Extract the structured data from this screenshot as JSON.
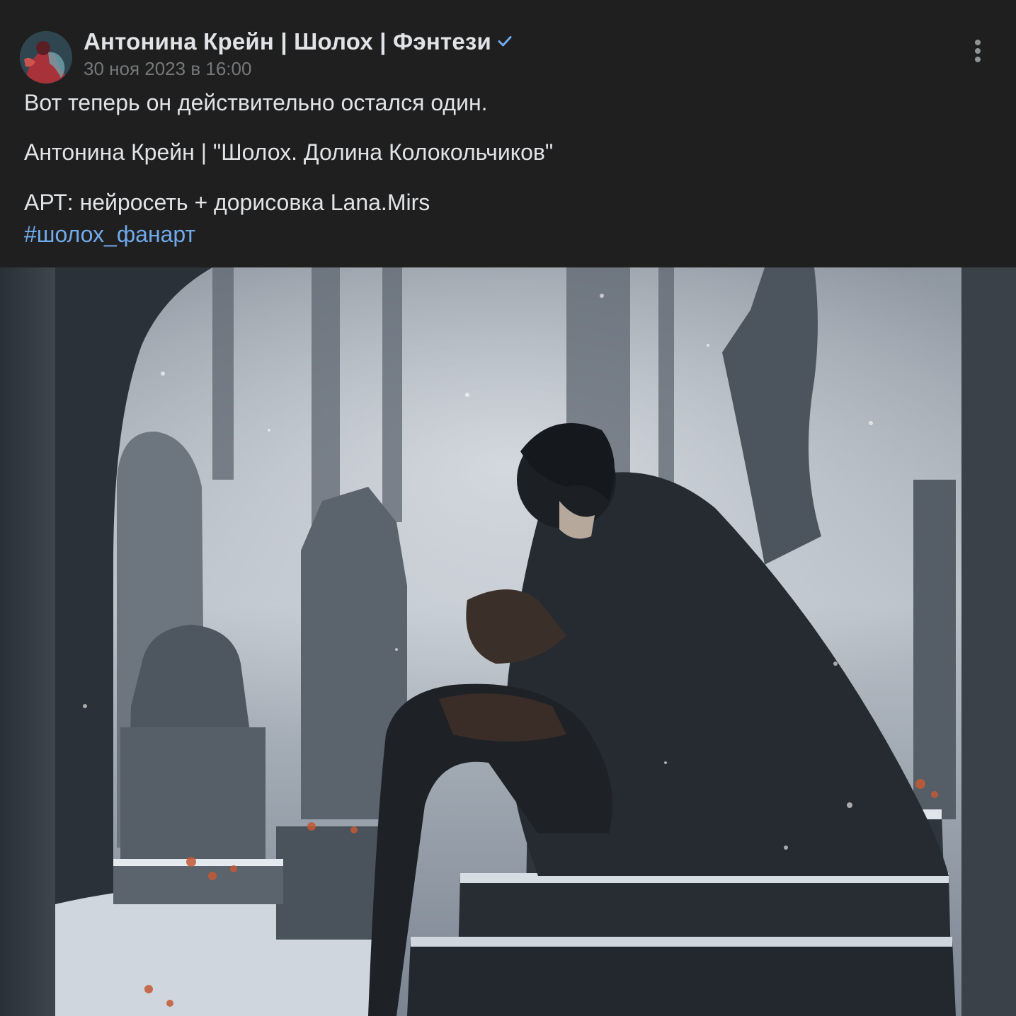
{
  "post": {
    "author": "Антонина Крейн | Шолох | Фэнтези",
    "verified": true,
    "date": "30 ноя 2023 в 16:00",
    "text_lines": [
      "Вот теперь он действительно остался один.",
      "Антонина Крейн | \"Шолох. Долина Колокольчиков\"",
      "АРТ: нейросеть + дорисовка Lana.Mirs"
    ],
    "hashtag": "#шолох_фанарт"
  },
  "icons": {
    "verified": "verified-check-icon",
    "menu": "more-vertical-icon"
  },
  "colors": {
    "background": "#1f1f1f",
    "text": "#e1e3e6",
    "secondary": "#76787a",
    "link": "#71aaeb"
  }
}
